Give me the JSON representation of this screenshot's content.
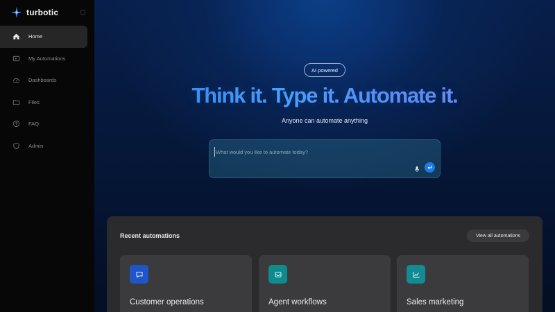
{
  "app": {
    "name": "turbotic"
  },
  "sidebar": {
    "items": [
      {
        "label": "Home",
        "icon": "home-icon",
        "active": true
      },
      {
        "label": "My Automations",
        "icon": "automations-icon",
        "active": false
      },
      {
        "label": "Dashboards",
        "icon": "dashboard-icon",
        "active": false
      },
      {
        "label": "Files",
        "icon": "folder-icon",
        "active": false
      },
      {
        "label": "FAQ",
        "icon": "help-icon",
        "active": false
      },
      {
        "label": "Admin",
        "icon": "shield-icon",
        "active": false
      }
    ]
  },
  "hero": {
    "badge": "AI powered",
    "headline": "Think it. Type it. Automate it.",
    "subtitle": "Anyone can automate anything",
    "prompt_placeholder": "What would you like to automate today?"
  },
  "recent": {
    "title": "Recent automations",
    "view_all": "View all automations",
    "cards": [
      {
        "title": "Customer operations",
        "icon": "chat-icon",
        "color": "#1e56c8"
      },
      {
        "title": "Agent workflows",
        "icon": "inbox-icon",
        "color": "#0f8b8d"
      },
      {
        "title": "Sales marketing",
        "icon": "chart-line-icon",
        "color": "#148a94"
      }
    ]
  },
  "colors": {
    "accent": "#1b7be6",
    "sidebar_bg": "#070707",
    "panel_bg": "#2b2b2d"
  }
}
